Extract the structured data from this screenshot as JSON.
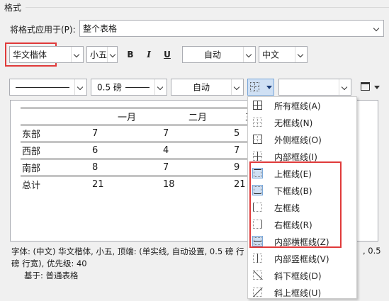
{
  "group_title": "格式",
  "apply_to": {
    "label": "将格式应用于(P):",
    "value": "整个表格"
  },
  "font": {
    "family": "华文楷体",
    "size": "小五",
    "bold": "B",
    "italic": "I",
    "underline": "U",
    "color": "自动",
    "script": "中文"
  },
  "border": {
    "style_name": "line",
    "width": "0.5 磅",
    "color": "自动",
    "border_type": "",
    "icon": "grid-border-icon"
  },
  "preview": {
    "header": [
      "",
      "一月",
      "二月",
      "三月"
    ],
    "rows": [
      [
        "东部",
        "7",
        "7",
        "5"
      ],
      [
        "西部",
        "6",
        "4",
        "7"
      ],
      [
        "南部",
        "8",
        "7",
        "9"
      ],
      [
        "总计",
        "21",
        "18",
        "21"
      ]
    ]
  },
  "description": {
    "line1": "字体: (中文) 华文楷体, 小五, 顶端: (单实线, 自动设置, 0.5 磅 行",
    "right_tail": ", 0.5",
    "line2": "磅 行宽), 优先级: 40",
    "line3": "基于: 普通表格"
  },
  "border_menu": [
    {
      "label": "所有框线(A)",
      "icon": "all-borders-icon"
    },
    {
      "label": "无框线(N)",
      "icon": "no-border-icon"
    },
    {
      "label": "外侧框线(O)",
      "icon": "outside-borders-icon"
    },
    {
      "label": "内部框线(I)",
      "icon": "inside-borders-icon"
    },
    {
      "label": "上框线(E)",
      "icon": "top-border-icon",
      "selected": true
    },
    {
      "label": "下框线(B)",
      "icon": "bottom-border-icon",
      "selected": true
    },
    {
      "label": "左框线",
      "icon": "left-border-icon"
    },
    {
      "label": "右框线(R)",
      "icon": "right-border-icon"
    },
    {
      "label": "内部横框线(Z)",
      "icon": "inside-horizontal-border-icon",
      "selected": true
    },
    {
      "label": "内部竖框线(V)",
      "icon": "inside-vertical-border-icon"
    },
    {
      "label": "斜下框线(D)",
      "icon": "diagonal-down-border-icon"
    },
    {
      "label": "斜上框线(U)",
      "icon": "diagonal-up-border-icon"
    }
  ],
  "colors": {
    "highlight_red": "#e03a3a",
    "selected_bg": "#cfe0f4",
    "selected_border": "#7aa7d8"
  }
}
